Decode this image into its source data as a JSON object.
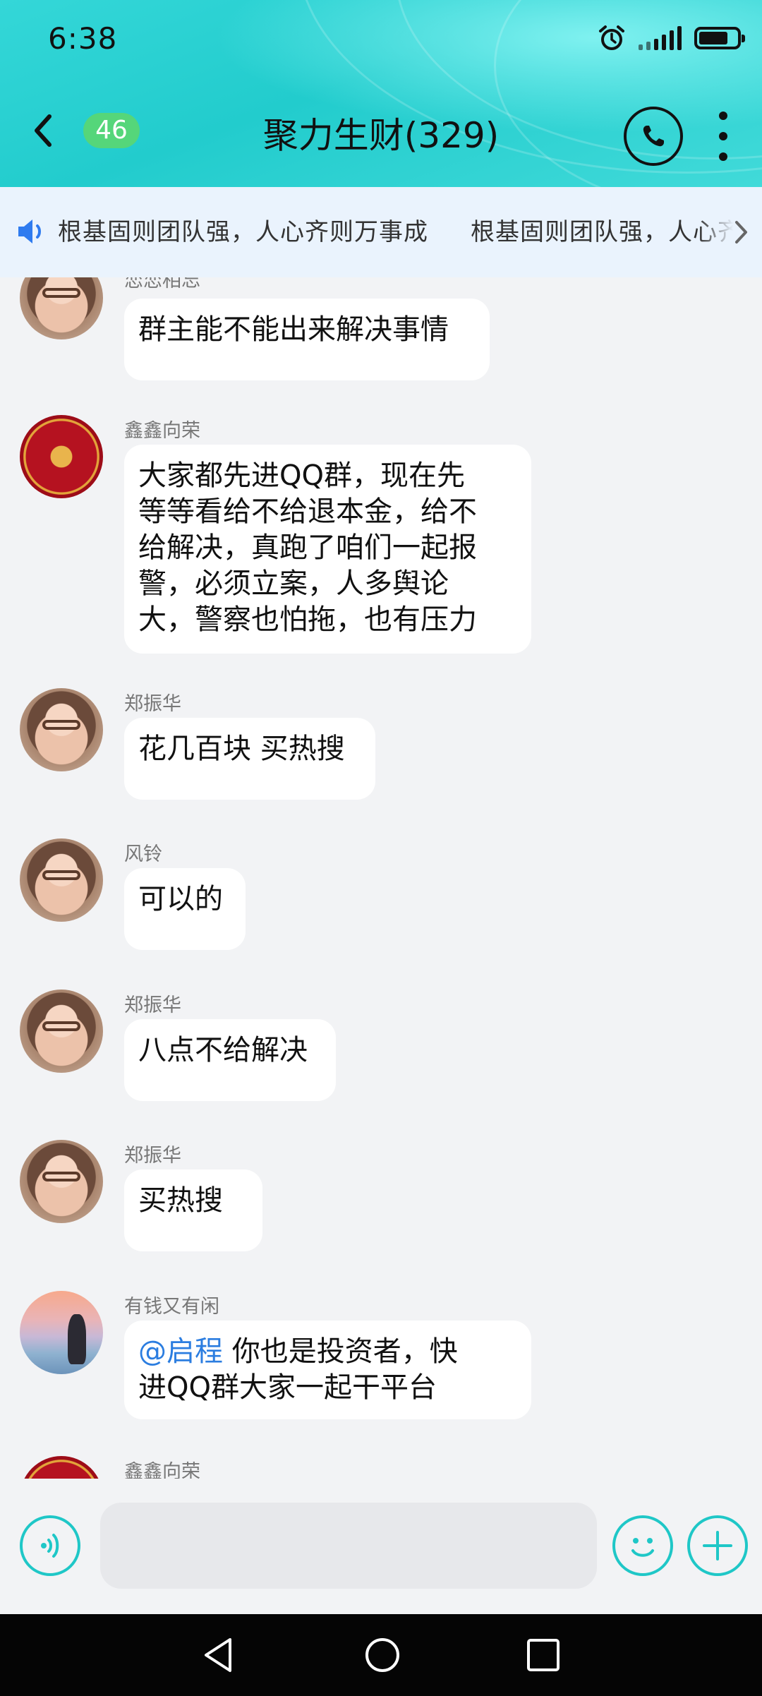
{
  "status_bar": {
    "time": "6:38"
  },
  "header": {
    "unread_count": "46",
    "title": "聚力生财(329)"
  },
  "announcement": {
    "text": "根基固则团队强，人心齐则万事成",
    "text_repeat": "根基固则团队强，人心齐则万事成"
  },
  "messages": [
    {
      "sender": "恋恋相忘",
      "text": "群主能不能出来解决事情",
      "avatar": "cartoon-girl-glasses"
    },
    {
      "sender": "鑫鑫向荣",
      "text": "大家都先进QQ群，现在先等等看给不给退本金，给不给解决，真跑了咱们一起报警，必须立案，人多舆论大，警察也怕拖，也有压力",
      "avatar": "red-dragon-emblem",
      "lines": [
        "大家都先进QQ群，现在先",
        "等等看给不给退本金，给不",
        "给解决，真跑了咱们一起报",
        "警，必须立案，人多舆论",
        "大，警察也怕拖，也有压力"
      ]
    },
    {
      "sender": "郑振华",
      "text": "花几百块 买热搜",
      "avatar": "cartoon-girl-glasses"
    },
    {
      "sender": "风铃",
      "text": "可以的",
      "avatar": "cartoon-girl-glasses"
    },
    {
      "sender": "郑振华",
      "text": "八点不给解决",
      "avatar": "cartoon-girl-glasses"
    },
    {
      "sender": "郑振华",
      "text": "买热搜",
      "avatar": "cartoon-girl-glasses"
    },
    {
      "sender": "有钱又有闲",
      "mention": "@启程",
      "text_after_mention": " 你也是投资者，快",
      "text_line2": "进QQ群大家一起干平台",
      "avatar": "sunset-beach-photo"
    },
    {
      "sender": "鑫鑫向荣",
      "avatar": "red-dragon-emblem"
    }
  ],
  "colors": {
    "header_teal": "#22cccd",
    "badge_green": "#55d67a",
    "mention_blue": "#2b7de0",
    "accent_teal": "#1fc7c7",
    "announcement_bg": "#eaf3fd"
  },
  "icons": [
    "alarm-icon",
    "signal-icon",
    "battery-icon",
    "back-arrow-icon",
    "phone-icon",
    "more-vertical-icon",
    "speaker-icon",
    "chevron-right-icon",
    "voice-icon",
    "emoji-icon",
    "plus-icon",
    "nav-back-icon",
    "nav-home-icon",
    "nav-recents-icon"
  ]
}
